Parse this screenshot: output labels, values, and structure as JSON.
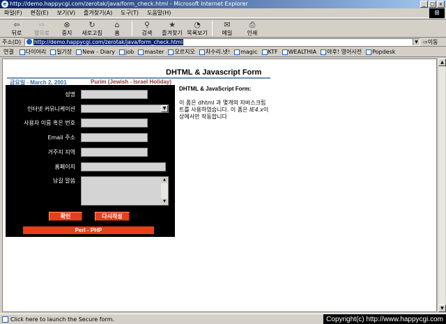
{
  "window": {
    "title": "http://demo.happycgi.com/zerotak/java/form_check.html - Microsoft Internet Explorer",
    "buttons": [
      "_",
      "□",
      "x"
    ]
  },
  "menu": [
    "파일(F)",
    "편집(E)",
    "보기(V)",
    "즐겨찾기(A)",
    "도구(T)",
    "도움말(H)"
  ],
  "toolbar": [
    {
      "label": "뒤로",
      "icon": "back-arrow-icon",
      "glyph": "⇦",
      "disabled": false
    },
    {
      "label": "앞으로",
      "icon": "forward-arrow-icon",
      "glyph": "⇨",
      "disabled": true
    },
    {
      "label": "중지",
      "icon": "stop-icon",
      "glyph": "⊗",
      "disabled": false
    },
    {
      "label": "새로고침",
      "icon": "refresh-icon",
      "glyph": "↻",
      "disabled": false
    },
    {
      "label": "홈",
      "icon": "home-icon",
      "glyph": "⌂",
      "disabled": false
    },
    {
      "label": "검색",
      "icon": "search-icon",
      "glyph": "⚲",
      "disabled": false
    },
    {
      "label": "즐겨찾기",
      "icon": "favorites-icon",
      "glyph": "★",
      "disabled": false
    },
    {
      "label": "목록보기",
      "icon": "history-icon",
      "glyph": "◔",
      "disabled": false
    },
    {
      "label": "메일",
      "icon": "mail-icon",
      "glyph": "✉",
      "disabled": false
    },
    {
      "label": "인쇄",
      "icon": "print-icon",
      "glyph": "⎙",
      "disabled": false
    }
  ],
  "address": {
    "label": "주소(D)",
    "url": "http://demo.happycgi.com/zerotak/java/form_check.html",
    "go": "이동"
  },
  "links": {
    "label": "연결",
    "items": [
      "다이어리",
      "일기장",
      "New - Diary",
      "job",
      "master",
      "오르지오",
      "차수리.넷!",
      "magic",
      "KTF",
      "WEALTHIA",
      "야후! 영어사전",
      "Popdesk"
    ]
  },
  "page": {
    "title": "DHTML & Javascript Form",
    "date": "금요일 - March 2, 2001",
    "holiday": "Purim (Jewish - Israel Holiday)",
    "form": {
      "name_label": "성명",
      "community_label": "인터넷 커뮤니케이션",
      "userid_label": "사용자 이름 혹은 번호",
      "email_label": "Email 주소",
      "region_label": "거주지 지역",
      "homepage_label": "홈페이지",
      "message_label": "남길 말씀",
      "confirm_button": "확인",
      "reset_button": "다시작성",
      "perl_php": "Perl - PHP"
    },
    "description_title": "DHTML & JavaScript Form:",
    "description_body": "이 폼은 dhtml 과 몇개의 자바스크립트를 사용하였습니다. 이 폼은 ",
    "description_em": "IE4.x",
    "description_tail": "이상에서만 작동합니다"
  },
  "status": {
    "text": "Click here to launch the Secure form.",
    "copyright": "Copyright(c) http://www.happycgi.com"
  }
}
